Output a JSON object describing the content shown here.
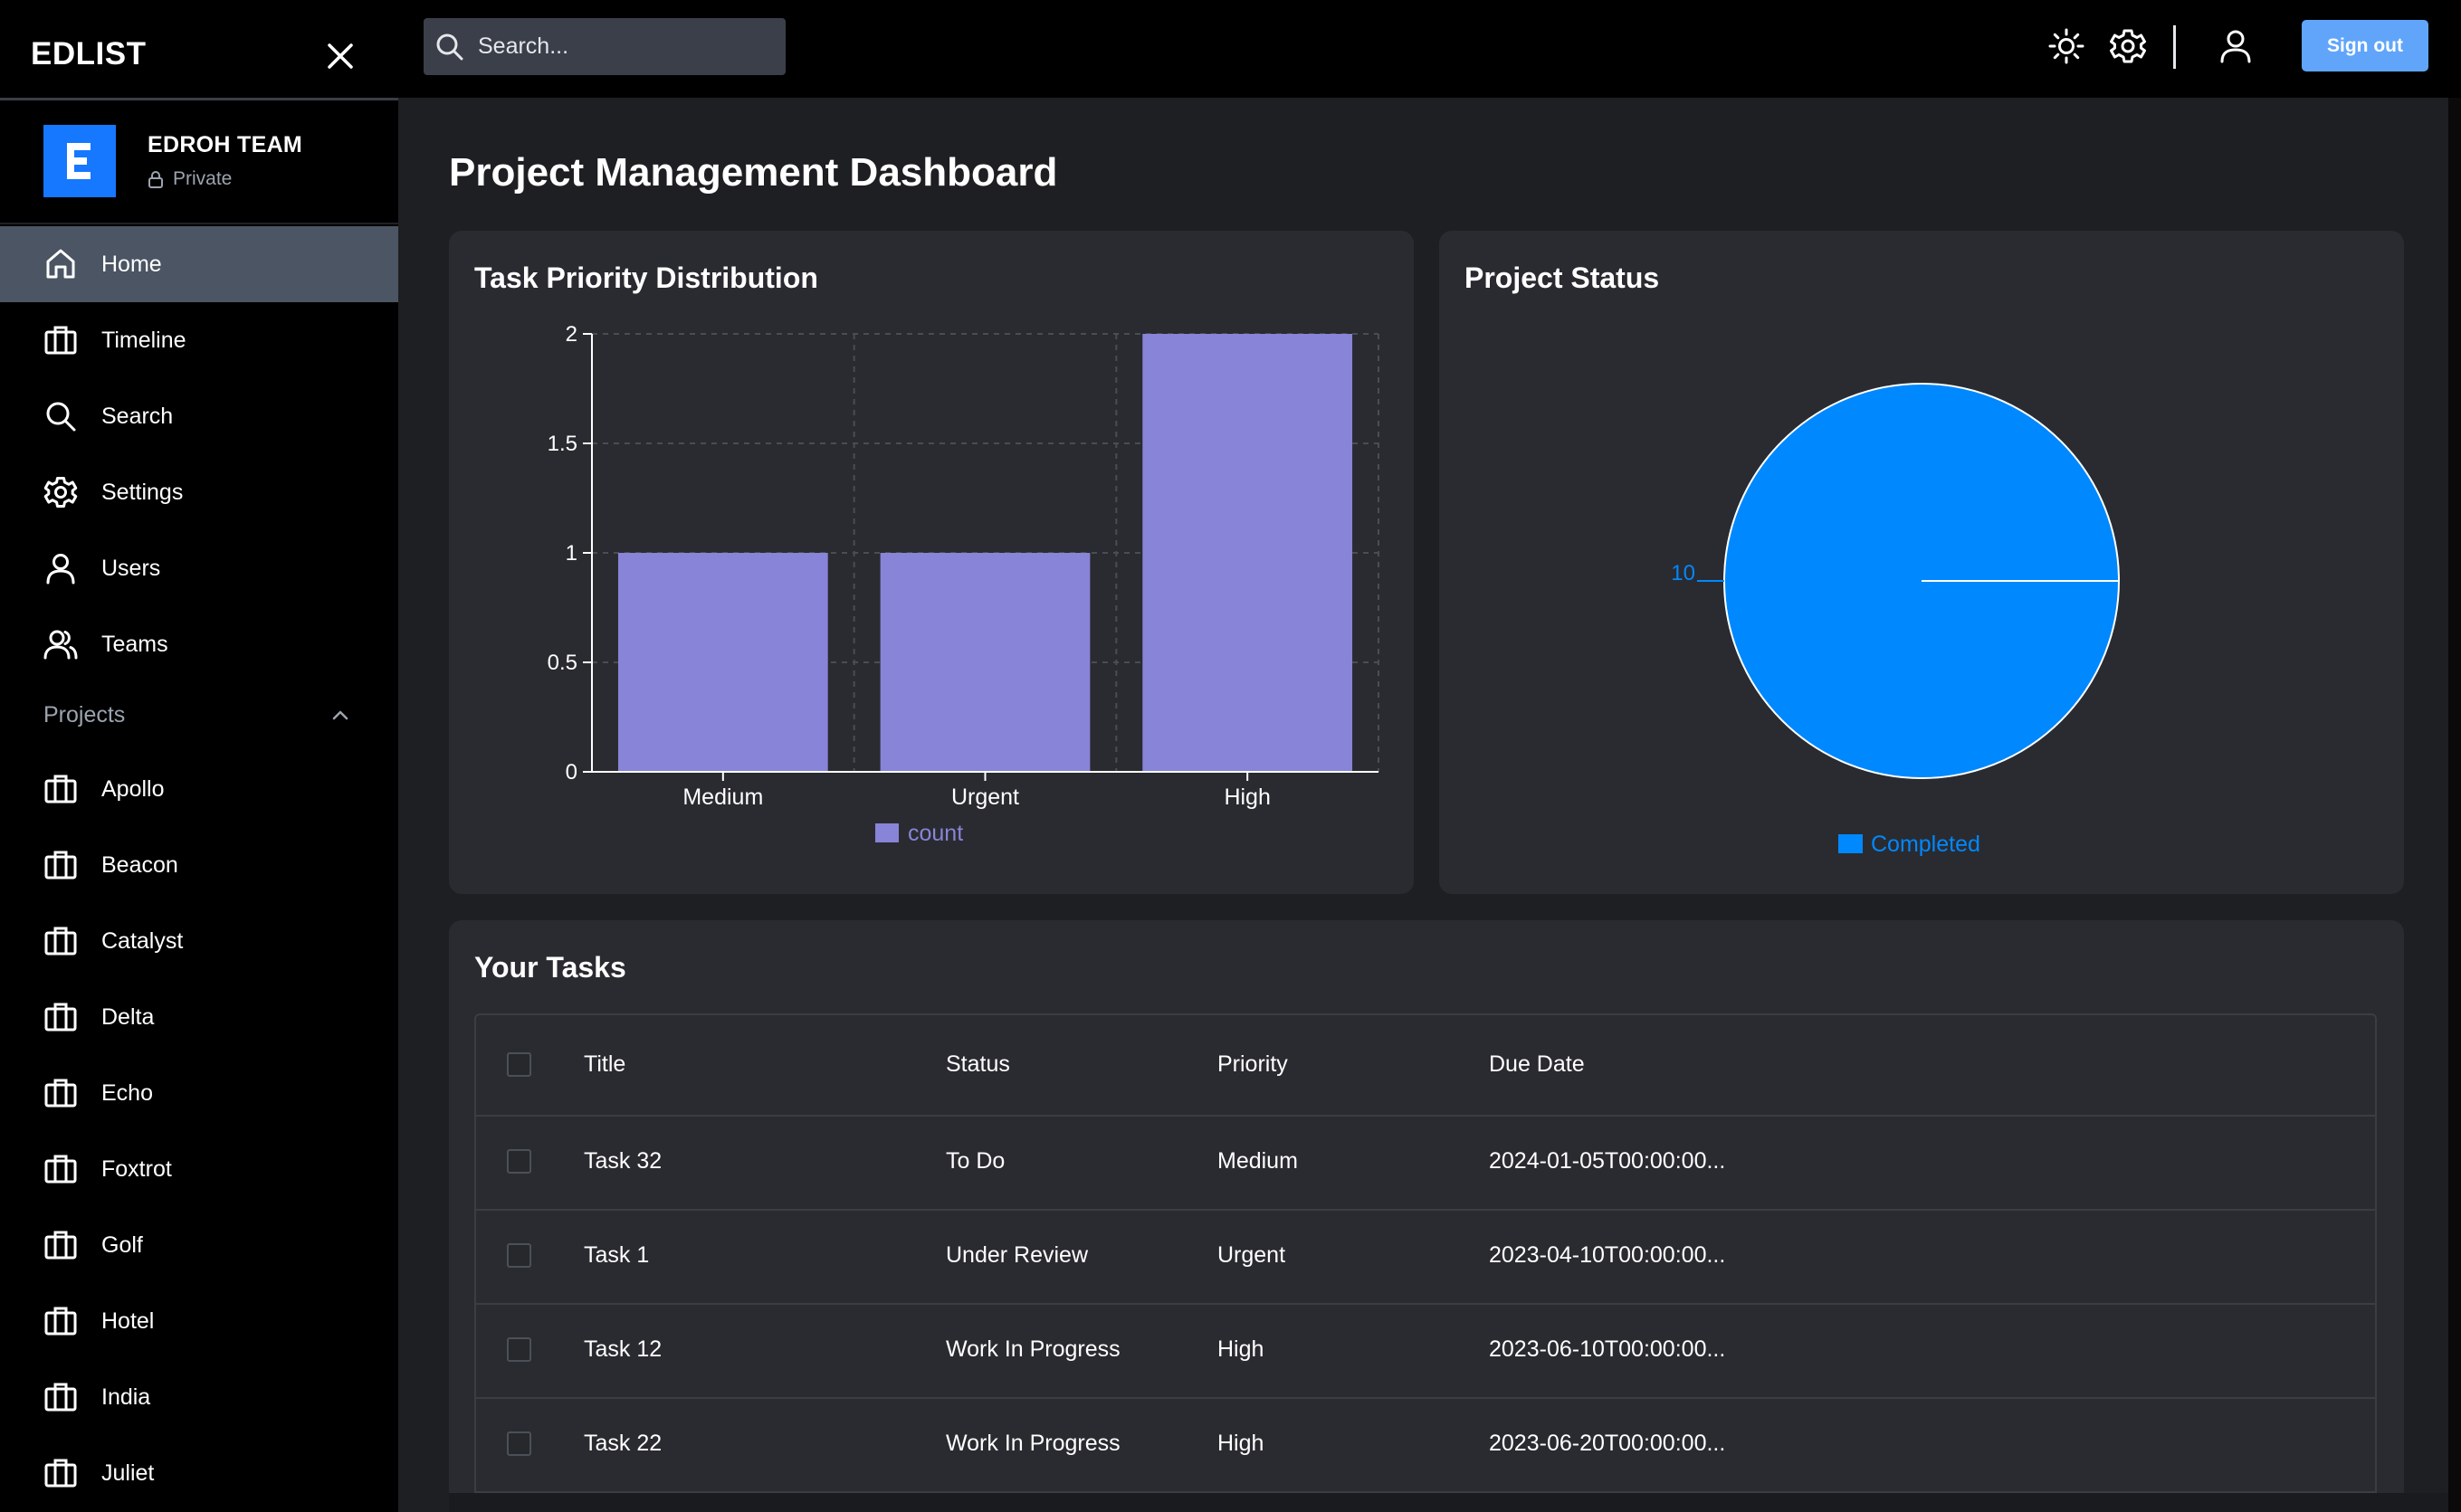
{
  "app": {
    "brand": "EDLIST"
  },
  "team": {
    "initial": "E",
    "name": "EDROH TEAM",
    "visibility": "Private"
  },
  "sidebar": {
    "nav": [
      {
        "label": "Home",
        "icon": "home-icon",
        "active": true
      },
      {
        "label": "Timeline",
        "icon": "briefcase-icon",
        "active": false
      },
      {
        "label": "Search",
        "icon": "search-icon",
        "active": false
      },
      {
        "label": "Settings",
        "icon": "gear-icon",
        "active": false
      },
      {
        "label": "Users",
        "icon": "user-icon",
        "active": false
      },
      {
        "label": "Teams",
        "icon": "users-icon",
        "active": false
      }
    ],
    "projects_label": "Projects",
    "projects": [
      "Apollo",
      "Beacon",
      "Catalyst",
      "Delta",
      "Echo",
      "Foxtrot",
      "Golf",
      "Hotel",
      "India",
      "Juliet"
    ]
  },
  "topbar": {
    "search_placeholder": "Search...",
    "signout_label": "Sign out",
    "icons": [
      "sun-icon",
      "gear-icon",
      "user-icon"
    ]
  },
  "main": {
    "title": "Project Management Dashboard",
    "priority_card_title": "Task Priority Distribution",
    "status_card_title": "Project Status",
    "tasks_card_title": "Your Tasks"
  },
  "chart_data": [
    {
      "type": "bar",
      "title": "Task Priority Distribution",
      "categories": [
        "Medium",
        "Urgent",
        "High"
      ],
      "series": [
        {
          "name": "count",
          "values": [
            1,
            1,
            2
          ],
          "color": "#8884d8"
        }
      ],
      "ylim": [
        0,
        2
      ],
      "yticks": [
        "0",
        "0.5",
        "1",
        "1.5",
        "2"
      ],
      "grid": true,
      "legend": "bottom-center"
    },
    {
      "type": "pie",
      "title": "Project Status",
      "slices": [
        {
          "name": "Completed",
          "value": 10,
          "label": "10",
          "color": "#0088fe"
        }
      ],
      "legend": "bottom-center"
    }
  ],
  "tasks": {
    "columns": [
      "Title",
      "Status",
      "Priority",
      "Due Date"
    ],
    "rows": [
      {
        "title": "Task 32",
        "status": "To Do",
        "priority": "Medium",
        "due": "2024-01-05T00:00:00..."
      },
      {
        "title": "Task 1",
        "status": "Under Review",
        "priority": "Urgent",
        "due": "2023-04-10T00:00:00..."
      },
      {
        "title": "Task 12",
        "status": "Work In Progress",
        "priority": "High",
        "due": "2023-06-10T00:00:00..."
      },
      {
        "title": "Task 22",
        "status": "Work In Progress",
        "priority": "High",
        "due": "2023-06-20T00:00:00..."
      }
    ]
  },
  "colors": {
    "accent": "#1677ff",
    "bar": "#8884d8",
    "pie": "#0088fe",
    "signout": "#60a5fa",
    "active_nav": "#4b5563"
  }
}
